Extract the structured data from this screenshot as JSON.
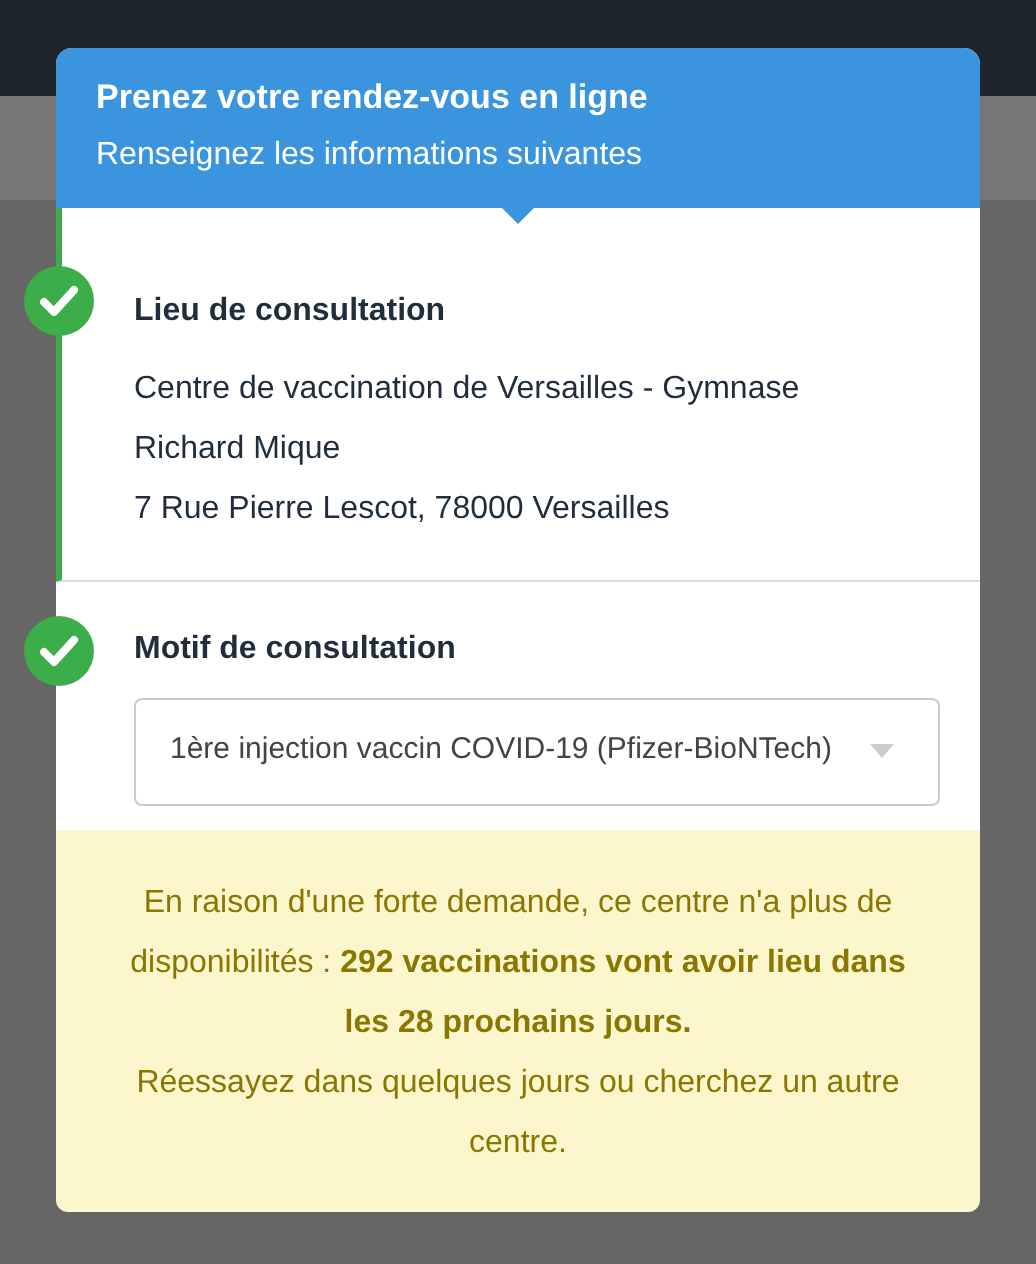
{
  "header": {
    "title": "Prenez votre rendez-vous en ligne",
    "subtitle": "Renseignez les informations suivantes"
  },
  "steps": [
    {
      "kind": "text",
      "label": "Lieu de consultation",
      "done": true,
      "lines": [
        "Centre de vaccination de Versailles - Gymnase Richard Mique",
        "7 Rue Pierre Lescot, 78000 Versailles"
      ]
    },
    {
      "kind": "select",
      "label": "Motif de consultation",
      "done": true,
      "value": "1ère injection vaccin COVID-19 (Pfizer-BioNTech)"
    }
  ],
  "alert": {
    "paragraphs": [
      "En raison d'une forte demande, ce centre n'a plus de disponibilités : **292 vaccinations vont avoir lieu dans les 28 prochains jours.**",
      "Réessayez dans quelques jours ou cherchez un autre centre."
    ]
  }
}
